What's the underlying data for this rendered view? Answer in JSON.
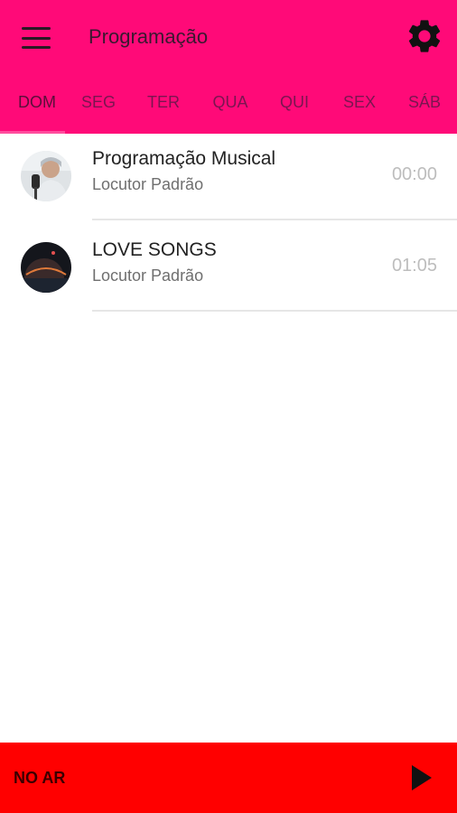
{
  "header": {
    "title": "Programação",
    "menu_icon": "hamburger-menu-icon",
    "settings_icon": "gear-icon",
    "background": "#ff0a78"
  },
  "tabs": [
    {
      "label": "DOM",
      "active": true
    },
    {
      "label": "SEG",
      "active": false
    },
    {
      "label": "TER",
      "active": false
    },
    {
      "label": "QUA",
      "active": false
    },
    {
      "label": "QUI",
      "active": false
    },
    {
      "label": "SEX",
      "active": false
    },
    {
      "label": "SÁB",
      "active": false
    }
  ],
  "schedule": [
    {
      "title": "Programação Musical",
      "host": "Locutor Padrão",
      "time": "00:00"
    },
    {
      "title": "LOVE SONGS",
      "host": "Locutor Padrão",
      "time": "01:05"
    }
  ],
  "player": {
    "status": "NO AR",
    "play_icon": "play-icon",
    "background": "#ff0000"
  }
}
